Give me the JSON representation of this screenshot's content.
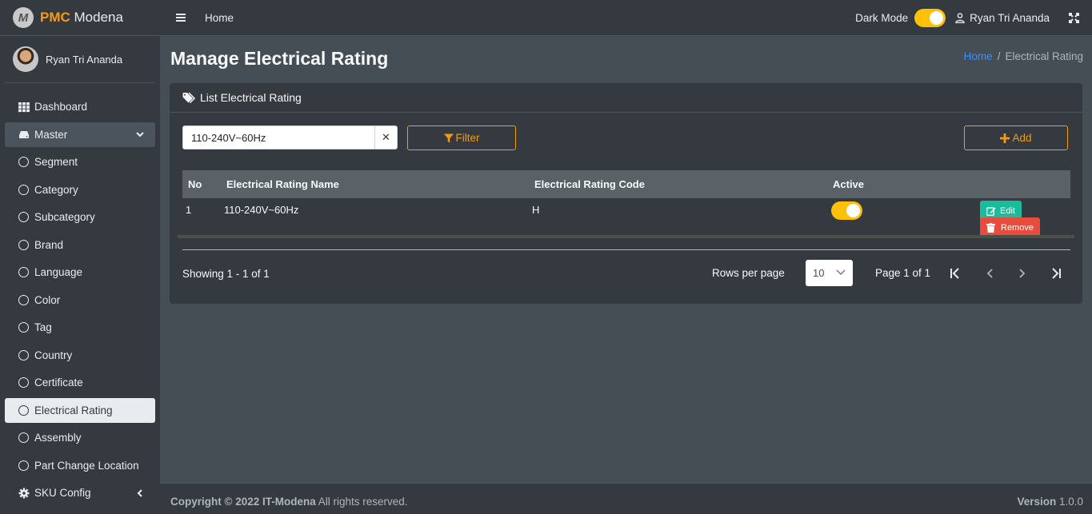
{
  "brand": {
    "name_bold": "PMC",
    "name_rest": " Modena",
    "logo_letter": "M"
  },
  "sidebar": {
    "user_name": "Ryan Tri Ananda",
    "items": [
      {
        "label": "Dashboard",
        "icon": "grid-icon"
      },
      {
        "label": "Master",
        "icon": "hdd-icon"
      },
      {
        "label": "Segment"
      },
      {
        "label": "Category"
      },
      {
        "label": "Subcategory"
      },
      {
        "label": "Brand"
      },
      {
        "label": "Language"
      },
      {
        "label": "Color"
      },
      {
        "label": "Tag"
      },
      {
        "label": "Country"
      },
      {
        "label": "Certificate"
      },
      {
        "label": "Electrical Rating"
      },
      {
        "label": "Assembly"
      },
      {
        "label": "Part Change Location"
      },
      {
        "label": "SKU Config",
        "icon": "gear-icon"
      }
    ]
  },
  "topbar": {
    "home": "Home",
    "dark_mode_label": "Dark Mode",
    "dark_mode_on": true,
    "user_name": "Ryan Tri Ananda"
  },
  "header": {
    "title": "Manage Electrical Rating",
    "breadcrumb_home": "Home",
    "breadcrumb_sep": "/",
    "breadcrumb_current": "Electrical Rating"
  },
  "card": {
    "title": "List Electrical Rating",
    "search_value": "110-240V~60Hz",
    "clear_symbol": "✕",
    "filter_label": "Filter",
    "add_label": "Add",
    "columns": [
      "No",
      "Electrical Rating Name",
      "Electrical Rating Code",
      "Active"
    ],
    "rows": [
      {
        "no": "1",
        "name": "110-240V~60Hz",
        "code": "H",
        "active": true,
        "edit_label": "Edit",
        "remove_label": "Remove"
      }
    ],
    "showing": "Showing 1 - 1 of 1",
    "rows_per_page_label": "Rows per page",
    "rows_per_page_value": "10",
    "page_info": "Page 1 of 1"
  },
  "footer": {
    "copyright_bold": "Copyright © 2022 IT-Modena",
    "copyright_rest": " All rights reserved.",
    "version_label": "Version",
    "version_value": " 1.0.0"
  },
  "colors": {
    "accent": "#f39c12",
    "toggle": "#ffc107",
    "edit": "#1abc9c",
    "remove": "#e74c3c",
    "link": "#3f8cff"
  }
}
